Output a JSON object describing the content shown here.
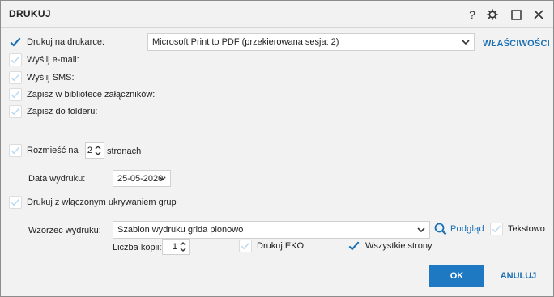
{
  "window": {
    "title": "DRUKUJ",
    "help_label": "?"
  },
  "options": {
    "print_to_printer": {
      "label": "Drukuj na drukarce:",
      "checked": true
    },
    "send_email": {
      "label": "Wyślij e-mail:",
      "checked": false
    },
    "send_sms": {
      "label": "Wyślij SMS:",
      "checked": false
    },
    "save_to_attachments": {
      "label": "Zapisz w bibliotece załączników:",
      "checked": false
    },
    "save_to_folder": {
      "label": "Zapisz do folderu:",
      "checked": false
    }
  },
  "printer": {
    "selected": "Microsoft Print to PDF (przekierowana sesja: 2)",
    "properties_label": "WŁAŚCIWOŚCI"
  },
  "layout": {
    "distribute_label_before": "Rozmieść na",
    "pages_value": "2",
    "distribute_label_after": "stronach",
    "checked": false
  },
  "print_date": {
    "label": "Data wydruku:",
    "value": "25-05-2020"
  },
  "hidden_groups": {
    "label": "Drukuj z włączonym ukrywaniem grup",
    "checked": false
  },
  "template": {
    "label": "Wzorzec wydruku:",
    "selected": "Szablon wydruku grida pionowo",
    "preview_label": "Podgląd",
    "text_label": "Tekstowo",
    "text_checked": false
  },
  "copies": {
    "label": "Liczba kopii:",
    "value": "1"
  },
  "eko": {
    "label": "Drukuj EKO",
    "checked": false
  },
  "all_pages": {
    "label": "Wszystkie strony",
    "checked": true
  },
  "actions": {
    "ok_label": "OK",
    "cancel_label": "ANULUJ"
  },
  "colors": {
    "accent": "#1e78c2",
    "link": "#1a6fb3",
    "check": "#1a6fb3",
    "check_faint": "#b8d6ee"
  }
}
